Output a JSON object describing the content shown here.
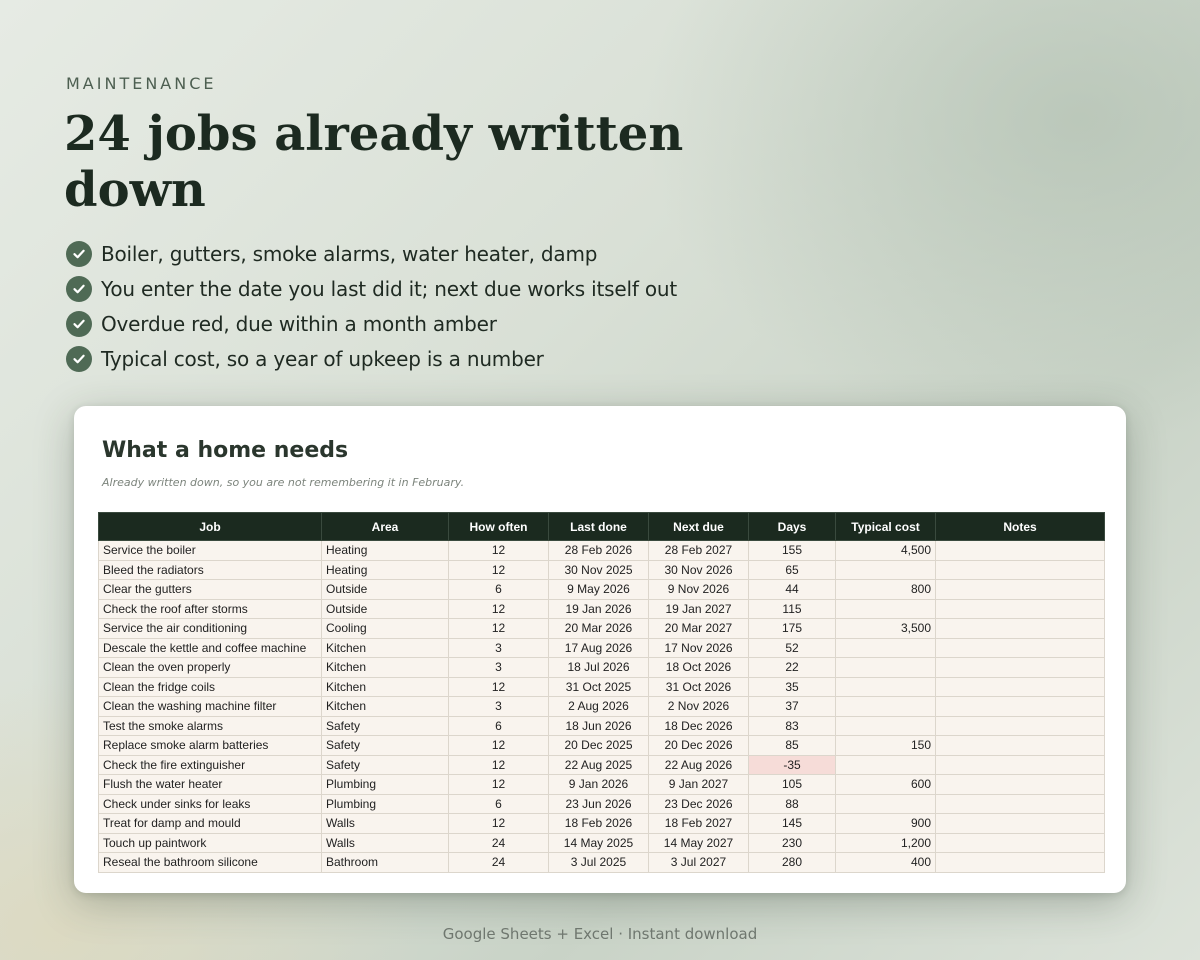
{
  "hero": {
    "eyebrow": "MAINTENANCE",
    "headline": "24 jobs already written down",
    "bullets": [
      "Boiler, gutters, smoke alarms, water heater, damp",
      "You enter the date you last did it; next due works itself out",
      "Overdue red, due within a month amber",
      "Typical cost, so a year of upkeep is a number"
    ]
  },
  "sheet": {
    "title": "What a home needs",
    "subtitle": "Already written down, so you are not remembering it in February.",
    "columns": [
      "Job",
      "Area",
      "How often",
      "Last done",
      "Next due",
      "Days",
      "Typical cost",
      "Notes"
    ],
    "rows": [
      {
        "job": "Service the boiler",
        "area": "Heating",
        "often": "12",
        "last": "28 Feb 2026",
        "next": "28 Feb 2027",
        "days": "155",
        "cost": "4,500",
        "notes": ""
      },
      {
        "job": "Bleed the radiators",
        "area": "Heating",
        "often": "12",
        "last": "30 Nov 2025",
        "next": "30 Nov 2026",
        "days": "65",
        "cost": "",
        "notes": ""
      },
      {
        "job": "Clear the gutters",
        "area": "Outside",
        "often": "6",
        "last": "9 May 2026",
        "next": "9 Nov 2026",
        "days": "44",
        "cost": "800",
        "notes": ""
      },
      {
        "job": "Check the roof after storms",
        "area": "Outside",
        "often": "12",
        "last": "19 Jan 2026",
        "next": "19 Jan 2027",
        "days": "115",
        "cost": "",
        "notes": ""
      },
      {
        "job": "Service the air conditioning",
        "area": "Cooling",
        "often": "12",
        "last": "20 Mar 2026",
        "next": "20 Mar 2027",
        "days": "175",
        "cost": "3,500",
        "notes": ""
      },
      {
        "job": "Descale the kettle and coffee machine",
        "area": "Kitchen",
        "often": "3",
        "last": "17 Aug 2026",
        "next": "17 Nov 2026",
        "days": "52",
        "cost": "",
        "notes": ""
      },
      {
        "job": "Clean the oven properly",
        "area": "Kitchen",
        "often": "3",
        "last": "18 Jul 2026",
        "next": "18 Oct 2026",
        "days": "22",
        "cost": "",
        "notes": ""
      },
      {
        "job": "Clean the fridge coils",
        "area": "Kitchen",
        "often": "12",
        "last": "31 Oct 2025",
        "next": "31 Oct 2026",
        "days": "35",
        "cost": "",
        "notes": ""
      },
      {
        "job": "Clean the washing machine filter",
        "area": "Kitchen",
        "often": "3",
        "last": "2 Aug 2026",
        "next": "2 Nov 2026",
        "days": "37",
        "cost": "",
        "notes": ""
      },
      {
        "job": "Test the smoke alarms",
        "area": "Safety",
        "often": "6",
        "last": "18 Jun 2026",
        "next": "18 Dec 2026",
        "days": "83",
        "cost": "",
        "notes": ""
      },
      {
        "job": "Replace smoke alarm batteries",
        "area": "Safety",
        "often": "12",
        "last": "20 Dec 2025",
        "next": "20 Dec 2026",
        "days": "85",
        "cost": "150",
        "notes": ""
      },
      {
        "job": "Check the fire extinguisher",
        "area": "Safety",
        "often": "12",
        "last": "22 Aug 2025",
        "next": "22 Aug 2026",
        "days": "-35",
        "cost": "",
        "notes": ""
      },
      {
        "job": "Flush the water heater",
        "area": "Plumbing",
        "often": "12",
        "last": "9 Jan 2026",
        "next": "9 Jan 2027",
        "days": "105",
        "cost": "600",
        "notes": ""
      },
      {
        "job": "Check under sinks for leaks",
        "area": "Plumbing",
        "often": "6",
        "last": "23 Jun 2026",
        "next": "23 Dec 2026",
        "days": "88",
        "cost": "",
        "notes": ""
      },
      {
        "job": "Treat for damp and mould",
        "area": "Walls",
        "often": "12",
        "last": "18 Feb 2026",
        "next": "18 Feb 2027",
        "days": "145",
        "cost": "900",
        "notes": ""
      },
      {
        "job": "Touch up paintwork",
        "area": "Walls",
        "often": "24",
        "last": "14 May 2025",
        "next": "14 May 2027",
        "days": "230",
        "cost": "1,200",
        "notes": ""
      },
      {
        "job": "Reseal the bathroom silicone",
        "area": "Bathroom",
        "often": "24",
        "last": "3 Jul 2025",
        "next": "3 Jul 2027",
        "days": "280",
        "cost": "400",
        "notes": ""
      }
    ]
  },
  "footer": "Google Sheets + Excel  ·  Instant download",
  "colors": {
    "header_bg": "#1b2a1f",
    "cell_bg": "#f9f4ee",
    "overdue_bg": "#f6dcd8",
    "check_bg": "#4f6a55"
  }
}
